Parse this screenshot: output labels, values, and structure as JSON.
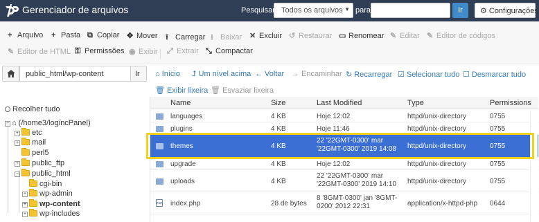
{
  "header": {
    "title": "Gerenciador de arquivos",
    "search_label": "Pesquisar",
    "search_scope": "Todos os arquivos",
    "for_label": "para",
    "search_value": "",
    "go_label": "Ir",
    "settings_label": "Configurações",
    "brand_color": "#2f3e55"
  },
  "toolbar": {
    "row1": [
      {
        "label": "Arquivo",
        "icon": "plus-icon",
        "enabled": true
      },
      {
        "label": "Pasta",
        "icon": "plus-icon",
        "enabled": true
      },
      {
        "label": "Copiar",
        "icon": "copy-icon",
        "enabled": true
      },
      {
        "label": "Mover",
        "icon": "move-icon",
        "enabled": true
      },
      {
        "label": "Carregar",
        "icon": "upload-icon",
        "enabled": true
      },
      {
        "label": "Baixar",
        "icon": "download-icon",
        "enabled": false
      },
      {
        "label": "Excluir",
        "icon": "delete-icon",
        "enabled": true
      },
      {
        "label": "Restaurar",
        "icon": "restore-icon",
        "enabled": false
      },
      {
        "label": "Renomear",
        "icon": "rename-icon",
        "enabled": true
      },
      {
        "label": "Editar",
        "icon": "pencil-icon",
        "enabled": false
      },
      {
        "label": "Editor de códigos",
        "icon": "code-editor-icon",
        "enabled": false
      }
    ],
    "row2": [
      {
        "label": "Editor de HTML",
        "icon": "html-editor-icon",
        "enabled": false
      },
      {
        "label": "Permissões",
        "icon": "key-icon",
        "enabled": true
      },
      {
        "label": "Exibir",
        "icon": "eye-icon",
        "enabled": false
      },
      {
        "label": "Extrair",
        "icon": "extract-icon",
        "enabled": false
      },
      {
        "label": "Compactar",
        "icon": "compress-icon",
        "enabled": true
      }
    ]
  },
  "pathbar": {
    "path": "public_html/wp-content",
    "go_label": "Ir"
  },
  "nav": {
    "home": "Início",
    "up": "Um nível acima",
    "back": "Voltar",
    "forward": "Encaminhar",
    "reload": "Recarregar",
    "select_all": "Selecionar tudo",
    "deselect_all": "Desmarcar tudo",
    "view_trash": "Exibir lixeira",
    "empty_trash": "Esvaziar lixeira"
  },
  "sidebar": {
    "collapse_all": "Recolher tudo",
    "root": "(/home3/logincPanel)",
    "items": [
      {
        "label": "etc"
      },
      {
        "label": "mail"
      },
      {
        "label": "perl5"
      },
      {
        "label": "public_ftp"
      },
      {
        "label": "public_html"
      },
      {
        "label": "cgi-bin"
      },
      {
        "label": "wp-admin"
      },
      {
        "label": "wp-content"
      },
      {
        "label": "wp-includes"
      }
    ]
  },
  "table": {
    "columns": [
      "Name",
      "Size",
      "Last Modified",
      "Type",
      "Permissions"
    ],
    "rows": [
      {
        "name": "languages",
        "size": "4 KB",
        "modified": "Hoje 12:02",
        "type": "httpd/unix-directory",
        "perms": "0755"
      },
      {
        "name": "plugins",
        "size": "4 KB",
        "modified": "Hoje 11:46",
        "type": "httpd/unix-directory",
        "perms": "0755"
      },
      {
        "name": "themes",
        "size": "4 KB",
        "modified": "22 '22GMT-0300' mar '22GMT-0300' 2019 14:08",
        "type": "httpd/unix-directory",
        "perms": "0755"
      },
      {
        "name": "upgrade",
        "size": "4 KB",
        "modified": "Hoje 12:02",
        "type": "httpd/unix-directory",
        "perms": "0755"
      },
      {
        "name": "uploads",
        "size": "4 KB",
        "modified": "22 '22GMT-0300' mar '22GMT-0300' 2019 14:10",
        "type": "httpd/unix-directory",
        "perms": "0755"
      },
      {
        "name": "index.php",
        "size": "28 de bytes",
        "modified": "8 '8GMT-0300' jan '8GMT-0200' 2012 22:31",
        "type": "application/x-httpd-php",
        "perms": "0644"
      }
    ],
    "selected_color": "#3b6fd4",
    "highlight_color": "#f0d21a"
  }
}
